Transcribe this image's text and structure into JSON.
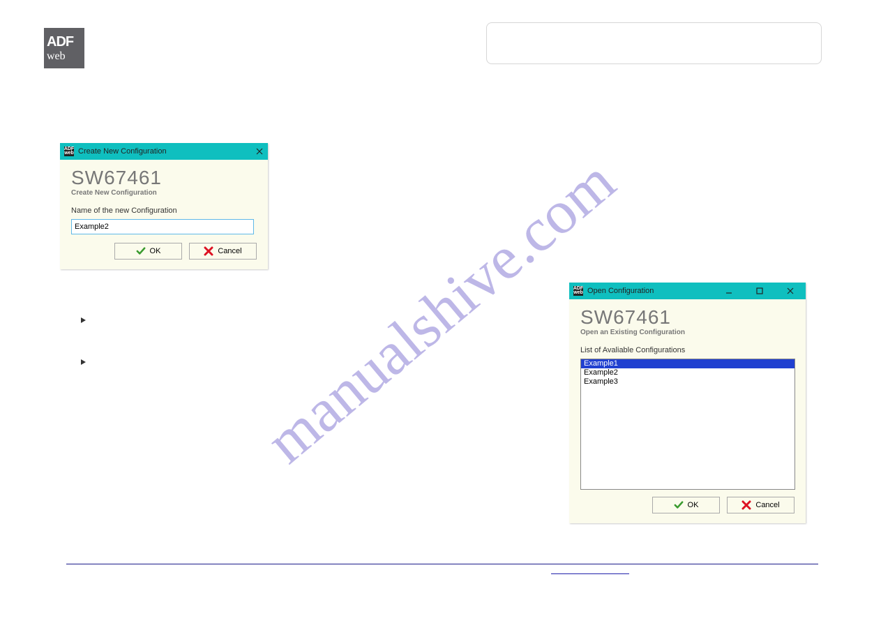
{
  "logo": {
    "line1": "ADF",
    "line2": "web"
  },
  "watermark": "manualshive.com",
  "dialog_create": {
    "title": "Create New Configuration",
    "app_title": "SW67461",
    "subtitle": "Create New Configuration",
    "field_label": "Name of the new Configuration",
    "input_value": "Example2",
    "ok_label": "OK",
    "cancel_label": "Cancel"
  },
  "dialog_open": {
    "title": "Open Configuration",
    "app_title": "SW67461",
    "subtitle": "Open an Existing Configuration",
    "list_label": "List of Avaliable Configurations",
    "items": [
      "Example1",
      "Example2",
      "Example3"
    ],
    "selected_index": 0,
    "ok_label": "OK",
    "cancel_label": "Cancel"
  }
}
